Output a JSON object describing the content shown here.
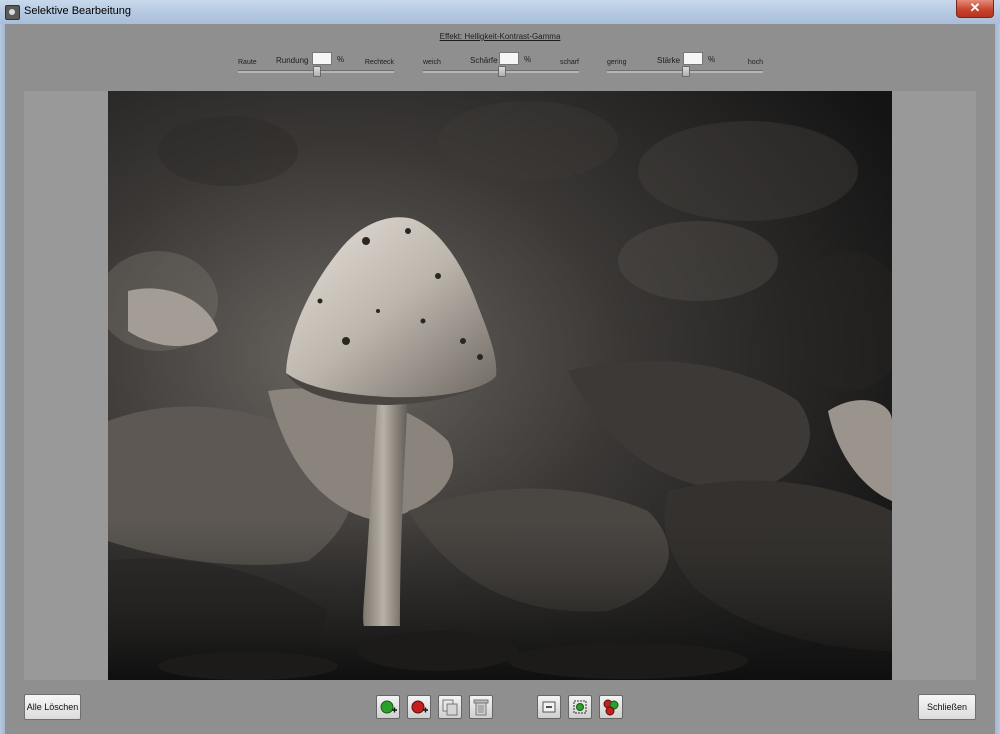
{
  "window": {
    "title": "Selektive Bearbeitung",
    "close_glyph": "✕"
  },
  "effect": {
    "label": "Effekt: Helligkeit-Kontrast-Gamma"
  },
  "sliders": [
    {
      "name": "Rundung",
      "left_label": "Raute",
      "right_label": "Rechteck",
      "value": "",
      "unit": "%",
      "level": 0.5
    },
    {
      "name": "Schärfe",
      "left_label": "weich",
      "right_label": "scharf",
      "value": "",
      "unit": "%",
      "level": 0.5
    },
    {
      "name": "Stärke",
      "left_label": "gering",
      "right_label": "hoch",
      "value": "",
      "unit": "%",
      "level": 0.5
    }
  ],
  "buttons": {
    "delete_all": "Alle Löschen",
    "close": "Schließen"
  },
  "tools": [
    {
      "id": "add-green",
      "icon": "add-green-marker-icon"
    },
    {
      "id": "add-red",
      "icon": "add-red-marker-icon"
    },
    {
      "id": "copy",
      "icon": "copy-icon"
    },
    {
      "id": "delete",
      "icon": "trash-icon"
    },
    {
      "id": "minus",
      "icon": "minus-icon"
    },
    {
      "id": "select-point",
      "icon": "select-point-icon"
    },
    {
      "id": "multi-markers",
      "icon": "multi-markers-icon"
    }
  ],
  "colors": {
    "marker_green": "#2aa12a",
    "marker_red": "#c41e1e",
    "background": "#8f8f8f"
  }
}
